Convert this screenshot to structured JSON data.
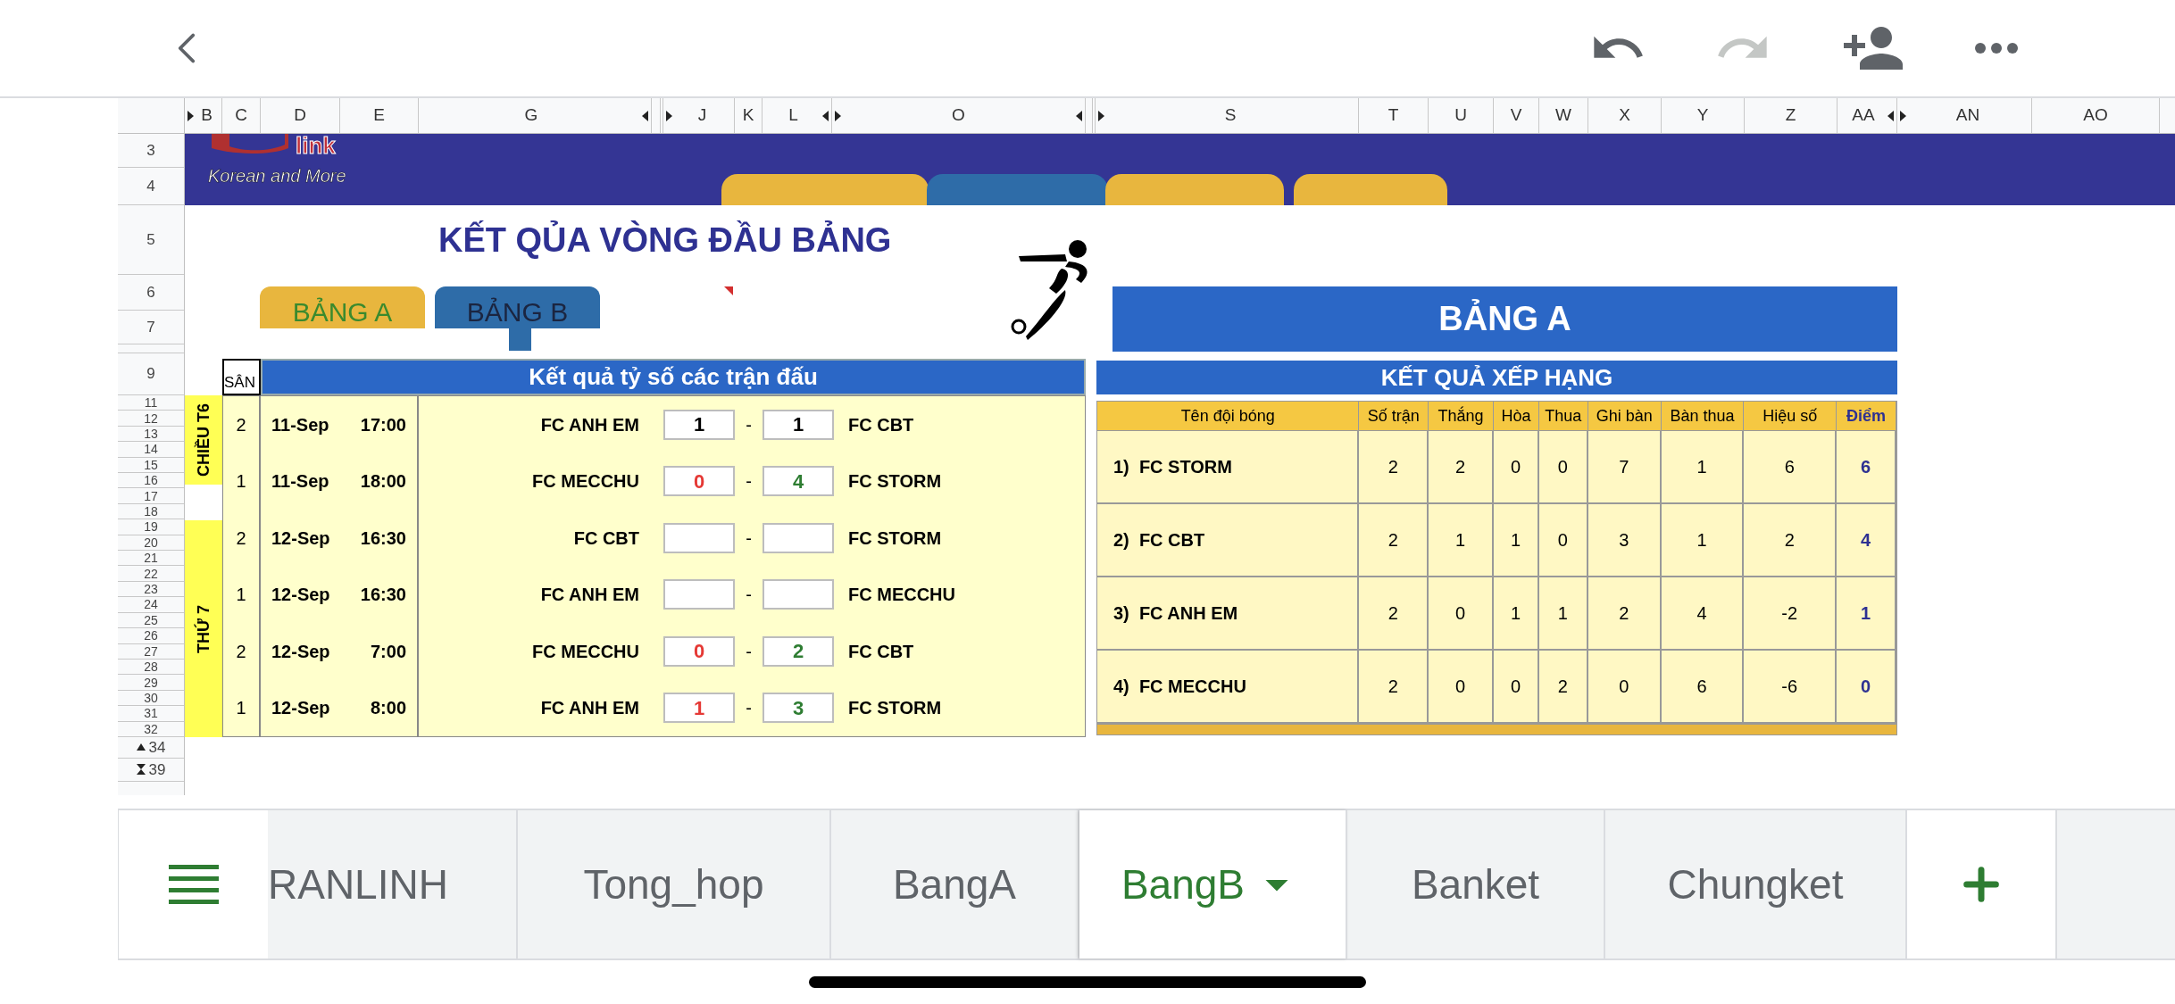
{
  "toolbar": [
    {
      "kind": "back",
      "disabled": false
    },
    {
      "kind": "undo",
      "disabled": false
    },
    {
      "kind": "redo",
      "disabled": true
    },
    {
      "kind": "add-person",
      "disabled": false
    },
    {
      "kind": "more",
      "disabled": false
    }
  ],
  "column_headers": [
    "B",
    "C",
    "D",
    "E",
    "G",
    "J",
    "K",
    "L",
    "O",
    "S",
    "T",
    "U",
    "V",
    "W",
    "X",
    "Y",
    "Z",
    "AA",
    "AN",
    "AO"
  ],
  "row_headers": [
    "3",
    "4",
    "5",
    "6",
    "7",
    "9",
    "11",
    "12",
    "13",
    "14",
    "15",
    "16",
    "17",
    "18",
    "19",
    "20",
    "21",
    "22",
    "23",
    "24",
    "25",
    "26",
    "27",
    "28",
    "29",
    "30",
    "31",
    "32",
    "34",
    "39"
  ],
  "banner": {
    "logo_text": "link",
    "tagline": "Korean and More"
  },
  "title": "KẾT QỦA VÒNG ĐẦU BẢNG",
  "group_buttons": [
    {
      "label": "BẢNG A",
      "color": "#e8b63e"
    },
    {
      "label": "BẢNG B",
      "color": "#2e6ca8"
    }
  ],
  "group_title": "BẢNG A",
  "schedule": {
    "court_header": "SÂN",
    "title": "Kết quả tỷ số các trận đấu",
    "days": [
      {
        "label": "CHIỀU T6"
      },
      {
        "label": "THỨ 7"
      }
    ],
    "matches": [
      {
        "court": "2",
        "date": "11-Sep",
        "time": "17:00",
        "home": "FC ANH EM",
        "home_score": {
          "value": "1",
          "color": "#000000"
        },
        "dash": "-",
        "away": "FC CBT",
        "away_score": {
          "value": "1",
          "color": "#000000"
        }
      },
      {
        "court": "1",
        "date": "11-Sep",
        "time": "18:00",
        "home": "FC MECCHU",
        "home_score": {
          "value": "0",
          "color": "#e53935"
        },
        "dash": "-",
        "away": "FC STORM",
        "away_score": {
          "value": "4",
          "color": "#2e7d32"
        }
      },
      {
        "court": "2",
        "date": "12-Sep",
        "time": "16:30",
        "home": "FC CBT",
        "dash": "-",
        "away": "FC STORM"
      },
      {
        "court": "1",
        "date": "12-Sep",
        "time": "16:30",
        "home": "FC ANH EM",
        "dash": "-",
        "away": "FC MECCHU"
      },
      {
        "court": "2",
        "date": "12-Sep",
        "time": "7:00",
        "home": "FC MECCHU",
        "home_score": {
          "value": "0",
          "color": "#e53935"
        },
        "dash": "-",
        "away": "FC CBT",
        "away_score": {
          "value": "2",
          "color": "#2e7d32"
        }
      },
      {
        "court": "1",
        "date": "12-Sep",
        "time": "8:00",
        "home": "FC ANH EM",
        "home_score": {
          "value": "1",
          "color": "#e53935"
        },
        "dash": "-",
        "away": "FC STORM",
        "away_score": {
          "value": "3",
          "color": "#2e7d32"
        }
      }
    ]
  },
  "standings": {
    "title": "KẾT QUẢ XẾP HẠNG",
    "columns": [
      "Tên đội bóng",
      "Số trận",
      "Thắng",
      "Hòa",
      "Thua",
      "Ghi bàn",
      "Bàn thua",
      "Hiệu số",
      "Điểm"
    ],
    "rows": [
      [
        "1)  FC STORM",
        "2",
        "2",
        "0",
        "0",
        "7",
        "1",
        "6",
        "6"
      ],
      [
        "2)  FC CBT",
        "2",
        "1",
        "1",
        "0",
        "3",
        "1",
        "2",
        "4"
      ],
      [
        "3)  FC ANH EM",
        "2",
        "0",
        "1",
        "1",
        "2",
        "4",
        "-2",
        "1"
      ],
      [
        "4)  FC MECCHU",
        "2",
        "0",
        "0",
        "2",
        "0",
        "6",
        "-6",
        "0"
      ]
    ]
  },
  "sheet_tabs": [
    {
      "label": "RANLINH",
      "selected": false
    },
    {
      "label": "Tong_hop",
      "selected": false
    },
    {
      "label": "BangA",
      "selected": false
    },
    {
      "label": "BangB",
      "selected": true
    },
    {
      "label": "Banket",
      "selected": false
    },
    {
      "label": "Chungket",
      "selected": false
    }
  ]
}
